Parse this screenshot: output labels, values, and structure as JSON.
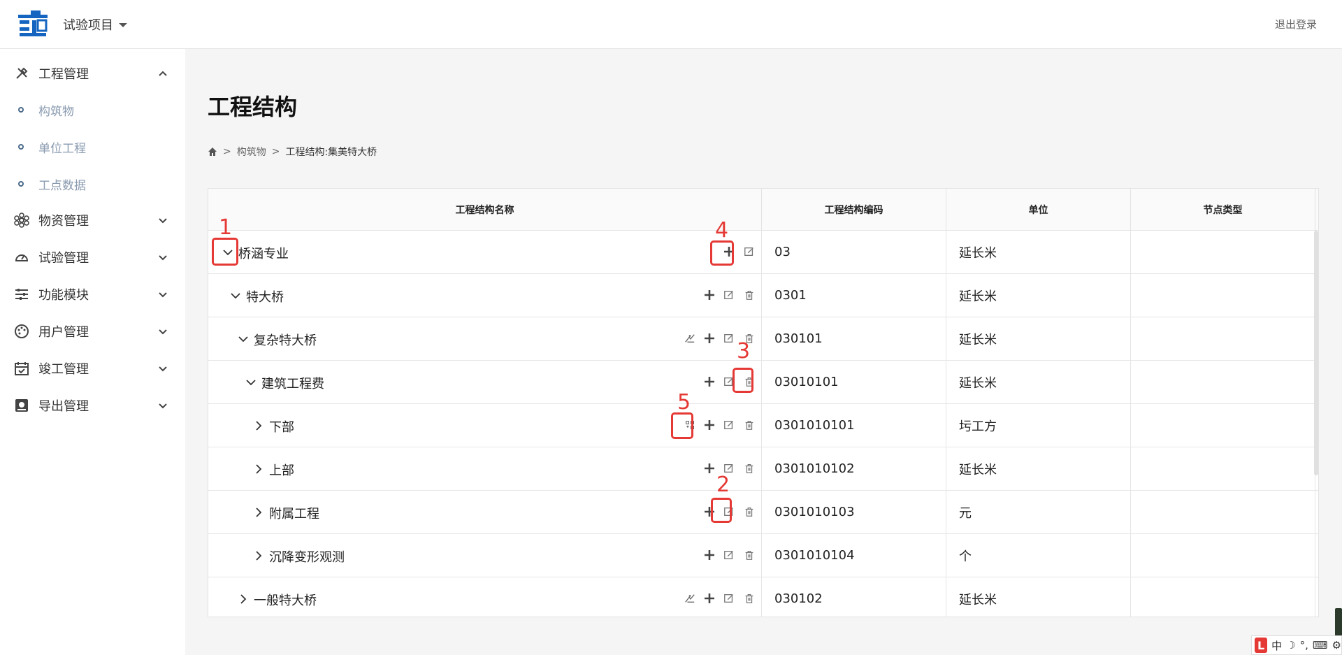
{
  "header": {
    "project_name": "试验项目",
    "logout": "退出登录"
  },
  "sidebar": {
    "groups": [
      {
        "label": "工程管理",
        "icon": "tools-icon",
        "expanded": true
      },
      {
        "label": "物资管理",
        "icon": "materials-icon",
        "expanded": false
      },
      {
        "label": "试验管理",
        "icon": "gauge-icon",
        "expanded": false
      },
      {
        "label": "功能模块",
        "icon": "sliders-icon",
        "expanded": false
      },
      {
        "label": "用户管理",
        "icon": "palette-icon",
        "expanded": false
      },
      {
        "label": "竣工管理",
        "icon": "calendar-check-icon",
        "expanded": false
      },
      {
        "label": "导出管理",
        "icon": "export-icon",
        "expanded": false
      }
    ],
    "sub_items": [
      "构筑物",
      "单位工程",
      "工点数据"
    ]
  },
  "page": {
    "title": "工程结构",
    "breadcrumb": {
      "link": "构筑物",
      "current": "工程结构:集美特大桥"
    }
  },
  "table": {
    "headers": [
      "工程结构名称",
      "工程结构编码",
      "单位",
      "节点类型"
    ],
    "rows": [
      {
        "name": "桥涵专业",
        "code": "03",
        "unit": "延长米",
        "node_type": "",
        "level": 0,
        "expanded": true,
        "actions": [
          "add",
          "edit"
        ]
      },
      {
        "name": "特大桥",
        "code": "0301",
        "unit": "延长米",
        "node_type": "",
        "level": 1,
        "expanded": true,
        "actions": [
          "add",
          "edit",
          "delete"
        ]
      },
      {
        "name": "复杂特大桥",
        "code": "030101",
        "unit": "延长米",
        "node_type": "",
        "level": 2,
        "expanded": true,
        "actions": [
          "structure",
          "add",
          "edit",
          "delete"
        ]
      },
      {
        "name": "建筑工程费",
        "code": "03010101",
        "unit": "延长米",
        "node_type": "",
        "level": 3,
        "expanded": true,
        "actions": [
          "add",
          "edit",
          "delete"
        ]
      },
      {
        "name": "下部",
        "code": "0301010101",
        "unit": "圬工方",
        "node_type": "",
        "level": 4,
        "expanded": false,
        "actions": [
          "grid",
          "add",
          "edit",
          "delete"
        ]
      },
      {
        "name": "上部",
        "code": "0301010102",
        "unit": "延长米",
        "node_type": "",
        "level": 4,
        "expanded": false,
        "actions": [
          "add",
          "edit",
          "delete"
        ]
      },
      {
        "name": "附属工程",
        "code": "0301010103",
        "unit": "元",
        "node_type": "",
        "level": 4,
        "expanded": false,
        "actions": [
          "add",
          "edit",
          "delete"
        ]
      },
      {
        "name": "沉降变形观测",
        "code": "0301010104",
        "unit": "个",
        "node_type": "",
        "level": 4,
        "expanded": false,
        "actions": [
          "add",
          "edit",
          "delete"
        ]
      },
      {
        "name": "一般特大桥",
        "code": "030102",
        "unit": "延长米",
        "node_type": "",
        "level": 2,
        "expanded": false,
        "actions": [
          "structure",
          "add",
          "edit",
          "delete"
        ]
      }
    ]
  },
  "annotations": [
    "1",
    "2",
    "3",
    "4",
    "5"
  ],
  "ime": {
    "lang": "中",
    "badge": "L"
  },
  "colors": {
    "accent_red": "#e53935",
    "sidebar_sub": "#8a9bb0",
    "logo_blue": "#1565c0"
  }
}
